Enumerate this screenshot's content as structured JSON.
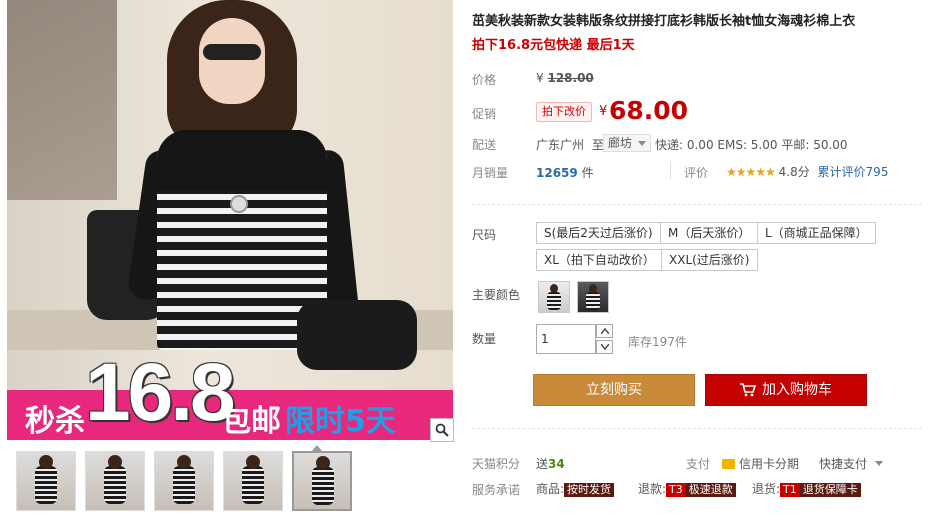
{
  "product": {
    "title": "茁美秋装新款女装韩版条纹拼接打底衫韩版长袖t恤女海魂衫棉上衣",
    "subtitle": "拍下16.8元包快递 最后1天"
  },
  "image": {
    "promo_prefix": "秒杀",
    "promo_price": "16.8",
    "promo_suffix": "包邮",
    "promo_time": "限时5天",
    "thumb_count": 5,
    "active_thumb": 5
  },
  "price": {
    "label": "价格",
    "yen": "¥",
    "original": "128.00"
  },
  "promo": {
    "label": "促销",
    "tag": "拍下改价",
    "yen": "¥",
    "value": "68.00"
  },
  "shipping": {
    "label": "配送",
    "from": "广东广州",
    "to_word": "至",
    "destination": "廊坊",
    "fees": "快递: 0.00 EMS: 5.00 平邮: 50.00"
  },
  "sales": {
    "label": "月销量",
    "count": "12659",
    "unit": "件",
    "rating_label": "评价",
    "stars": "★★★★★",
    "score": "4.8分",
    "total_reviews": "累计评价795"
  },
  "sizes": {
    "label": "尺码",
    "options": [
      "S(最后2天过后涨价)",
      "M（后天涨价）",
      "L（商城正品保障）",
      "XL（拍下自动改价）",
      "XXL(过后涨价)"
    ]
  },
  "colors": {
    "label": "主要颜色",
    "swatch_count": 2
  },
  "quantity": {
    "label": "数量",
    "value": "1",
    "stock": "库存197件"
  },
  "actions": {
    "buy_now": "立刻购买",
    "add_cart": "加入购物车"
  },
  "points": {
    "label": "天猫积分",
    "prefix": "送",
    "value": "34"
  },
  "payment": {
    "label": "支付",
    "credit": "信用卡分期",
    "quick": "快捷支付"
  },
  "service": {
    "label": "服务承诺",
    "goods_prefix": "商品:",
    "goods_tag": "按时发货",
    "refund_prefix": "退款:",
    "refund_tag_code": "T3",
    "refund_tag": "极速退款",
    "return_prefix": "退货:",
    "return_tag_code": "T1",
    "return_tag": "退货保障卡"
  },
  "colors_theme": {
    "price_red": "#c40000",
    "buy_orange": "#c98a3a",
    "promo_pink": "#e8287d",
    "link_blue": "#2b6aa6"
  }
}
